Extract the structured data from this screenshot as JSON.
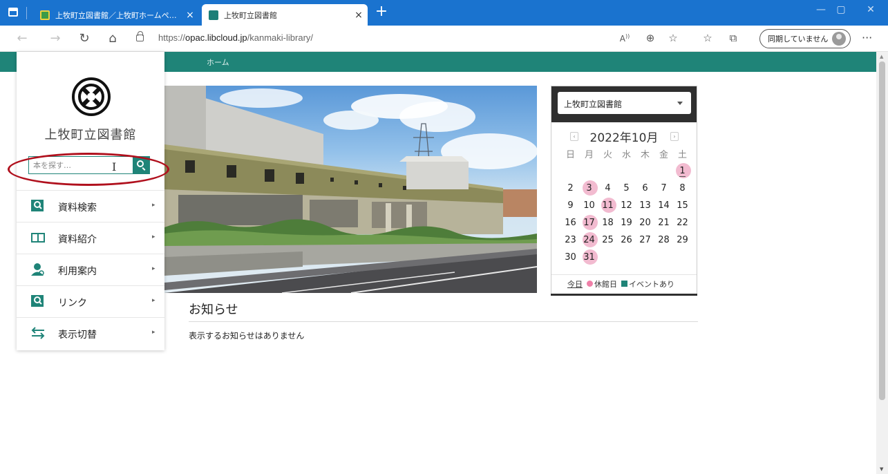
{
  "browser": {
    "tabs": [
      {
        "title": "上牧町立図書館／上牧町ホームページ",
        "active": false
      },
      {
        "title": "上牧町立図書館",
        "active": true
      }
    ],
    "new_tab_symbol": "+",
    "close_symbol": "×",
    "window_controls": {
      "minimize": "—",
      "restore": "▢",
      "close": "✕"
    },
    "url_prefix": "https://",
    "url_host": "opac.libcloud.jp",
    "url_path": "/kanmaki-library/",
    "sync_label": "同期していません",
    "icons": [
      "back-icon",
      "forward-icon",
      "refresh-icon",
      "home-icon",
      "read-aloud-icon",
      "zoom-icon",
      "favorite-add-icon",
      "favorites-icon",
      "collections-icon",
      "profile-icon",
      "more-icon"
    ]
  },
  "site": {
    "accent": "#1f8478",
    "nav": {
      "home": "ホーム"
    },
    "library_name": "上牧町立図書館",
    "search": {
      "placeholder": "本を探す…"
    },
    "menu": [
      {
        "label": "資料検索",
        "icon": "search-book-icon"
      },
      {
        "label": "資料紹介",
        "icon": "open-book-icon"
      },
      {
        "label": "利用案内",
        "icon": "user-guide-icon"
      },
      {
        "label": "リンク",
        "icon": "link-icon"
      },
      {
        "label": "表示切替",
        "icon": "swap-arrows-icon"
      }
    ],
    "menu_arrow": "▸"
  },
  "calendar": {
    "library_select": "上牧町立図書館",
    "month_label": "2022年10月",
    "weekdays": [
      "日",
      "月",
      "火",
      "水",
      "木",
      "金",
      "土"
    ],
    "weeks": [
      [
        "",
        "",
        "",
        "",
        "",
        "",
        "1"
      ],
      [
        "2",
        "3",
        "4",
        "5",
        "6",
        "7",
        "8"
      ],
      [
        "9",
        "10",
        "11",
        "12",
        "13",
        "14",
        "15"
      ],
      [
        "16",
        "17",
        "18",
        "19",
        "20",
        "21",
        "22"
      ],
      [
        "23",
        "24",
        "25",
        "26",
        "27",
        "28",
        "29"
      ],
      [
        "30",
        "31",
        "",
        "",
        "",
        "",
        ""
      ]
    ],
    "closed_days": [
      "1",
      "3",
      "11",
      "17",
      "24",
      "31"
    ],
    "today_day": "1",
    "legend": {
      "today": "今日",
      "closed": "休館日",
      "event": "イベントあり"
    },
    "closed_color": "#f2bbd0",
    "event_color": "#1f8478"
  },
  "news": {
    "title": "お知らせ",
    "empty_message": "表示するお知らせはありません"
  }
}
